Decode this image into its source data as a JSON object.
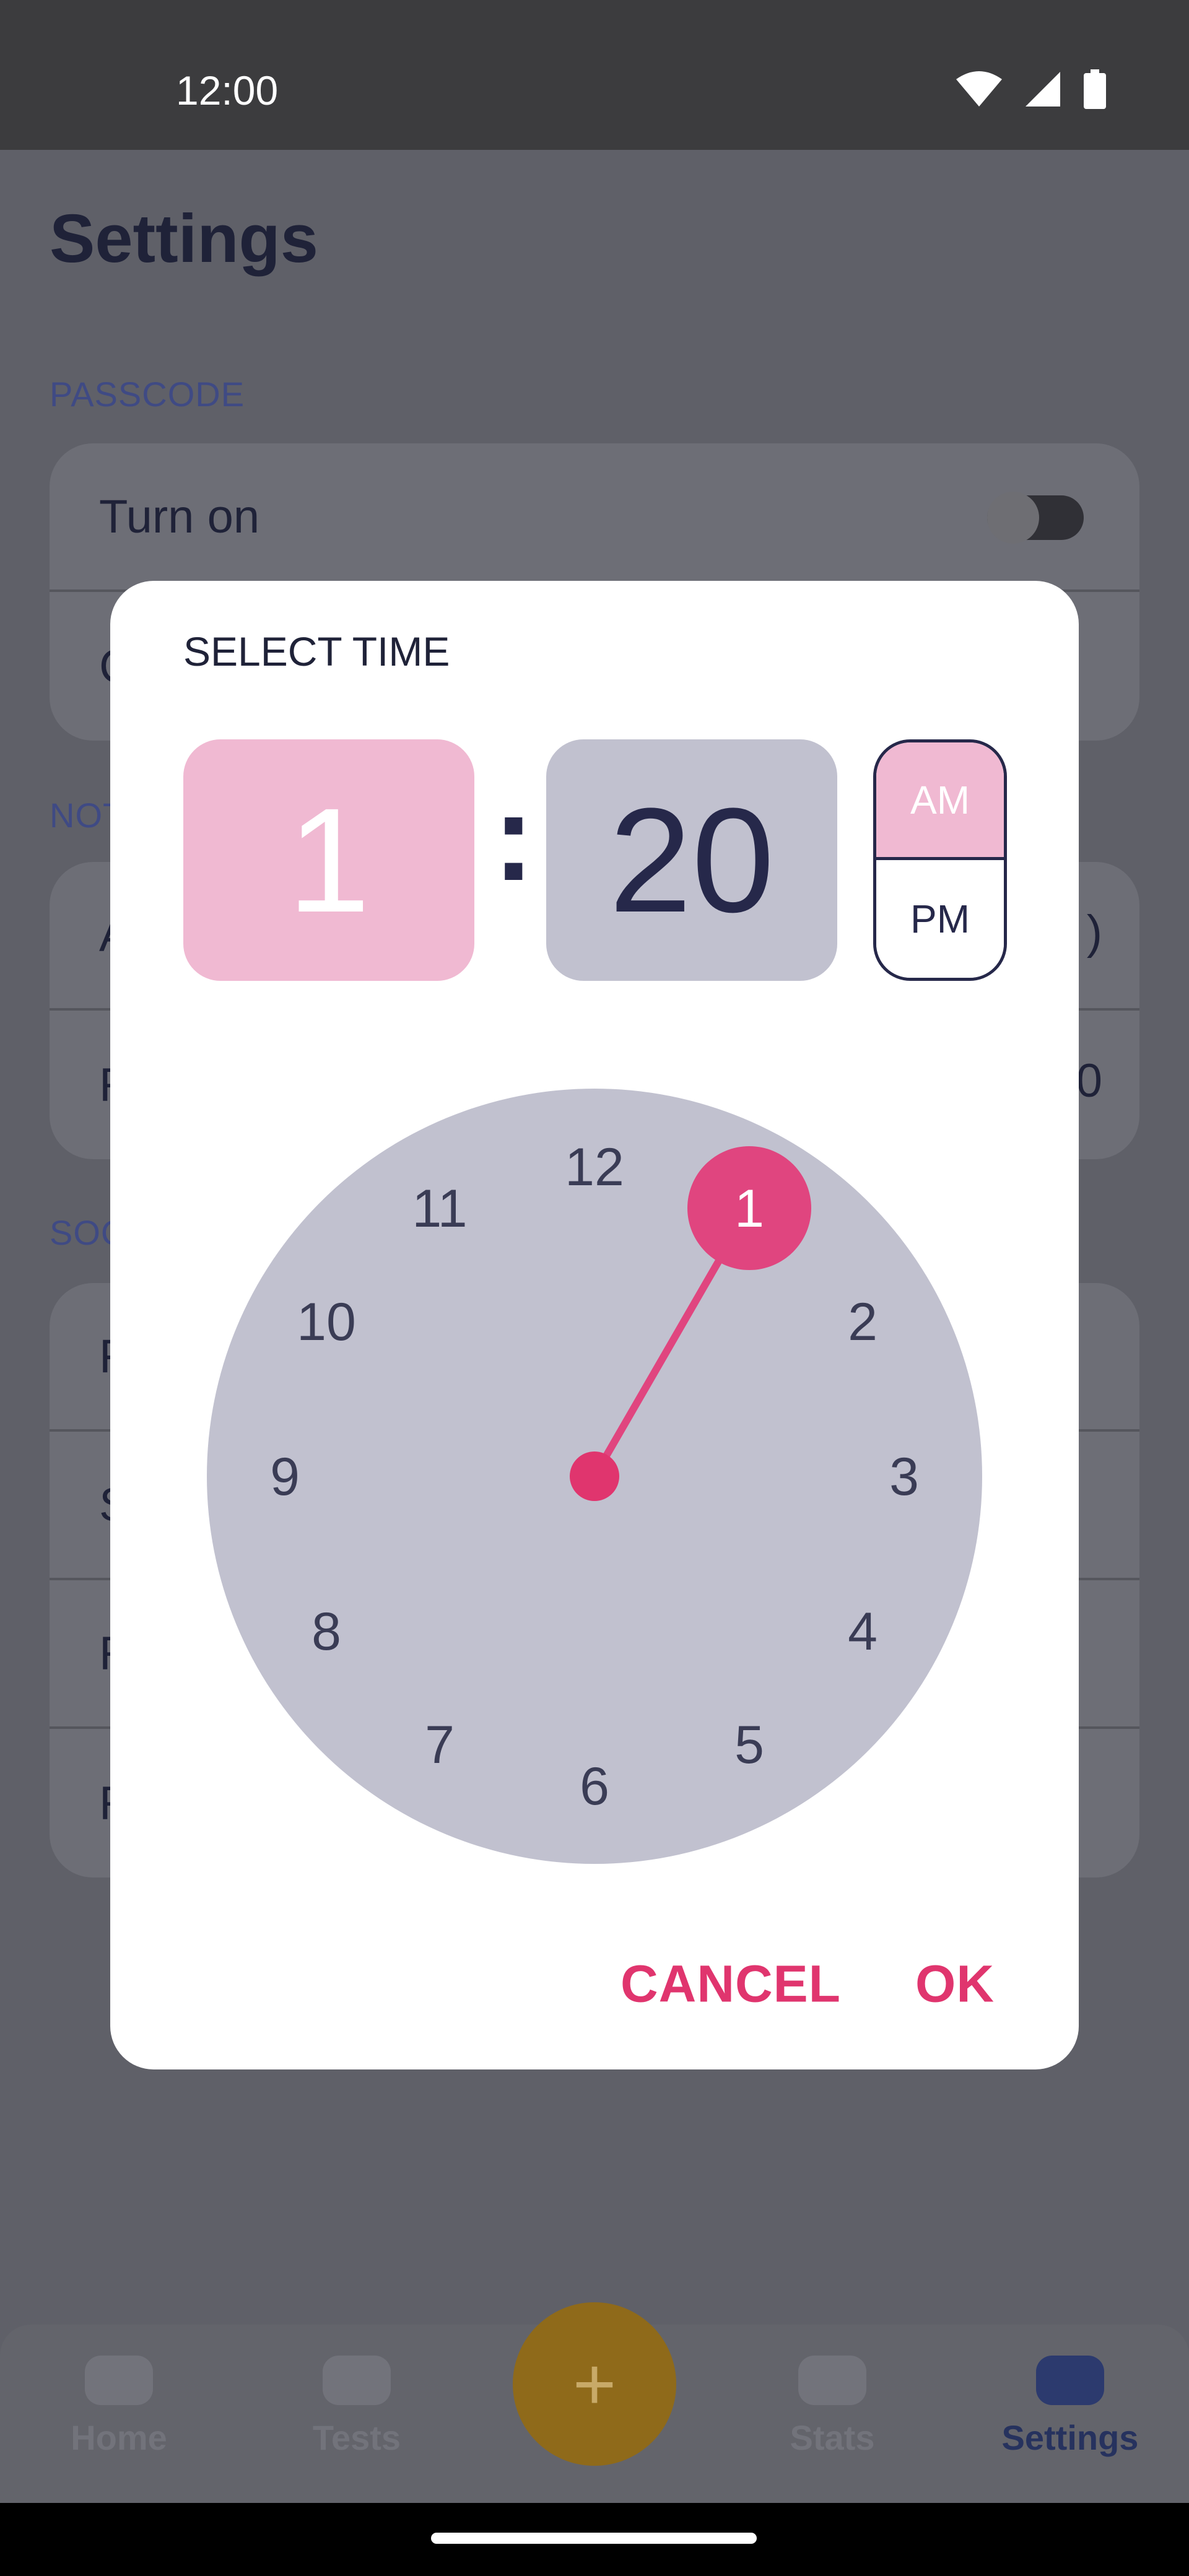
{
  "status_bar": {
    "time": "12:00",
    "icons": [
      "wifi-icon",
      "signal-icon",
      "battery-icon"
    ]
  },
  "settings": {
    "title": "Settings",
    "passcode_section": "PASSCODE",
    "turn_on_label": "Turn on",
    "turn_on_state": "off",
    "partial_row_initial": "C",
    "notifications_section_partial": "NOT",
    "notif_row_1_initial": "A",
    "notif_row_1_tail": ")",
    "notif_row_2_initial": "R",
    "notif_row_2_tail": "0",
    "social_section_partial": "SOC",
    "social_row_initials": [
      "F",
      "S",
      "R",
      "R"
    ]
  },
  "dialog": {
    "title": "SELECT TIME",
    "hour": "1",
    "separator": ":",
    "minute": "20",
    "am": "AM",
    "pm": "PM",
    "period_selected": "AM",
    "clock_numbers": [
      "12",
      "1",
      "2",
      "3",
      "4",
      "5",
      "6",
      "7",
      "8",
      "9",
      "10",
      "11"
    ],
    "selected_hour": "1",
    "cancel": "CANCEL",
    "ok": "OK"
  },
  "bottom_nav": {
    "items": [
      {
        "label": "Home",
        "icon": "home-icon"
      },
      {
        "label": "Tests",
        "icon": "tests-icon"
      },
      {
        "label": "Stats",
        "icon": "stats-icon"
      },
      {
        "label": "Settings",
        "icon": "settings-icon"
      }
    ],
    "active": "Settings",
    "fab_icon": "plus-icon",
    "fab_symbol": "+"
  },
  "colors": {
    "accent": "#e0356e",
    "hour_selected_bg": "#f0b9d2",
    "clock_face": "#c1c1cf",
    "fab": "#e0a11a",
    "text_dark": "#26284a"
  }
}
